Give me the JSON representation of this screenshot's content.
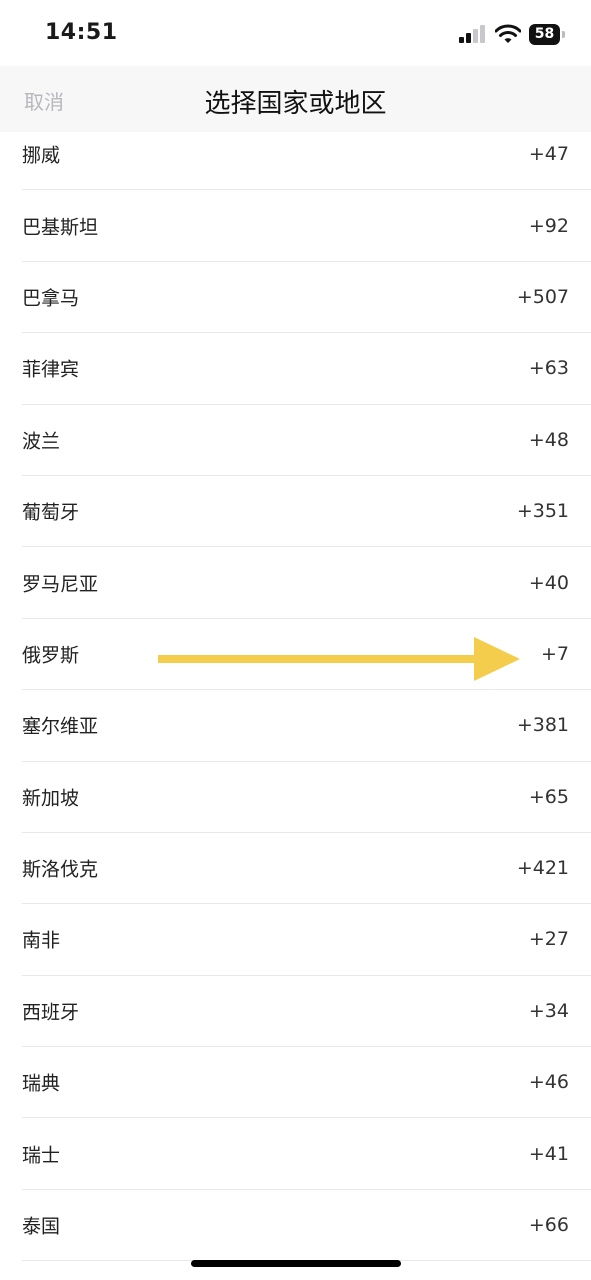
{
  "status_bar": {
    "time": "14:51",
    "battery": "58"
  },
  "nav": {
    "cancel_label": "取消",
    "title": "选择国家或地区"
  },
  "countries": [
    {
      "name": "挪威",
      "code": "+47"
    },
    {
      "name": "巴基斯坦",
      "code": "+92"
    },
    {
      "name": "巴拿马",
      "code": "+507"
    },
    {
      "name": "菲律宾",
      "code": "+63"
    },
    {
      "name": "波兰",
      "code": "+48"
    },
    {
      "name": "葡萄牙",
      "code": "+351"
    },
    {
      "name": "罗马尼亚",
      "code": "+40"
    },
    {
      "name": "俄罗斯",
      "code": "+7"
    },
    {
      "name": "塞尔维亚",
      "code": "+381"
    },
    {
      "name": "新加坡",
      "code": "+65"
    },
    {
      "name": "斯洛伐克",
      "code": "+421"
    },
    {
      "name": "南非",
      "code": "+27"
    },
    {
      "name": "西班牙",
      "code": "+34"
    },
    {
      "name": "瑞典",
      "code": "+46"
    },
    {
      "name": "瑞士",
      "code": "+41"
    },
    {
      "name": "泰国",
      "code": "+66"
    }
  ],
  "annotation": {
    "icon": "arrow-right-icon",
    "color": "#f5cd4c",
    "points_to_row": 7
  }
}
